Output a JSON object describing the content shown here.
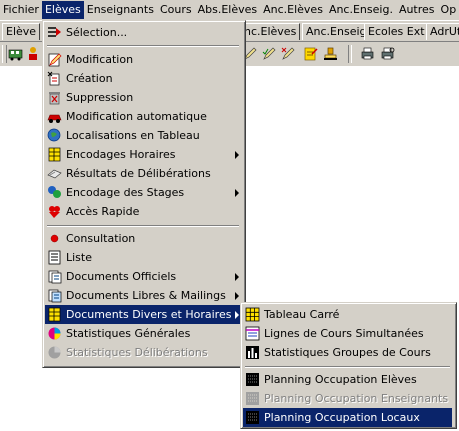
{
  "menubar": {
    "items": [
      "Fichier",
      "Elèves",
      "Enseignants",
      "Cours",
      "Abs.Elèves",
      "Anc.Elèves",
      "Anc.Enseig.",
      "Autres",
      "Op"
    ]
  },
  "tabs": [
    "Elève",
    "nc.Elèves",
    "Anc.Enseig",
    "Ecoles Ext",
    "AdrUt"
  ],
  "eleves_menu": {
    "items": [
      {
        "label": "Sélection...",
        "icon": "selection-icon"
      },
      {
        "label": "Modification",
        "icon": "modify-icon"
      },
      {
        "label": "Création",
        "icon": "create-icon"
      },
      {
        "label": "Suppression",
        "icon": "delete-icon"
      },
      {
        "label": "Modification automatique",
        "icon": "auto-modify-icon"
      },
      {
        "label": "Localisations en Tableau",
        "icon": "location-table-icon"
      },
      {
        "label": "Encodages Horaires",
        "icon": "schedule-encoding-icon"
      },
      {
        "label": "Résultats de Délibérations",
        "icon": "results-icon"
      },
      {
        "label": "Encodage des Stages",
        "icon": "internship-icon"
      },
      {
        "label": "Accès Rapide",
        "icon": "quick-access-icon"
      },
      {
        "label": "Consultation",
        "icon": "consultation-icon"
      },
      {
        "label": "Liste",
        "icon": "list-icon"
      },
      {
        "label": "Documents Officiels",
        "icon": "official-docs-icon"
      },
      {
        "label": "Documents Libres  & Mailings",
        "icon": "free-docs-icon"
      },
      {
        "label": "Documents Divers et Horaires",
        "icon": "misc-docs-icon"
      },
      {
        "label": "Statistiques Générales",
        "icon": "stats-icon"
      },
      {
        "label": "Statistiques Délibérations",
        "icon": "stats-delib-icon"
      }
    ]
  },
  "submenu": {
    "items": [
      {
        "label": "Tableau Carré",
        "icon": "grid-icon"
      },
      {
        "label": "Lignes de Cours Simultanées",
        "icon": "lines-icon"
      },
      {
        "label": "Statistiques Groupes de Cours",
        "icon": "group-stats-icon"
      },
      {
        "label": "Planning Occupation Elèves",
        "icon": "planning-icon"
      },
      {
        "label": "Planning Occupation Enseignants",
        "icon": "planning-icon"
      },
      {
        "label": "Planning Occupation Locaux",
        "icon": "planning-icon"
      }
    ]
  },
  "colors": {
    "menu_bg": "#d4d0c8",
    "highlight": "#0a246a",
    "highlight_text": "#ffffff",
    "disabled_text": "#808080"
  }
}
